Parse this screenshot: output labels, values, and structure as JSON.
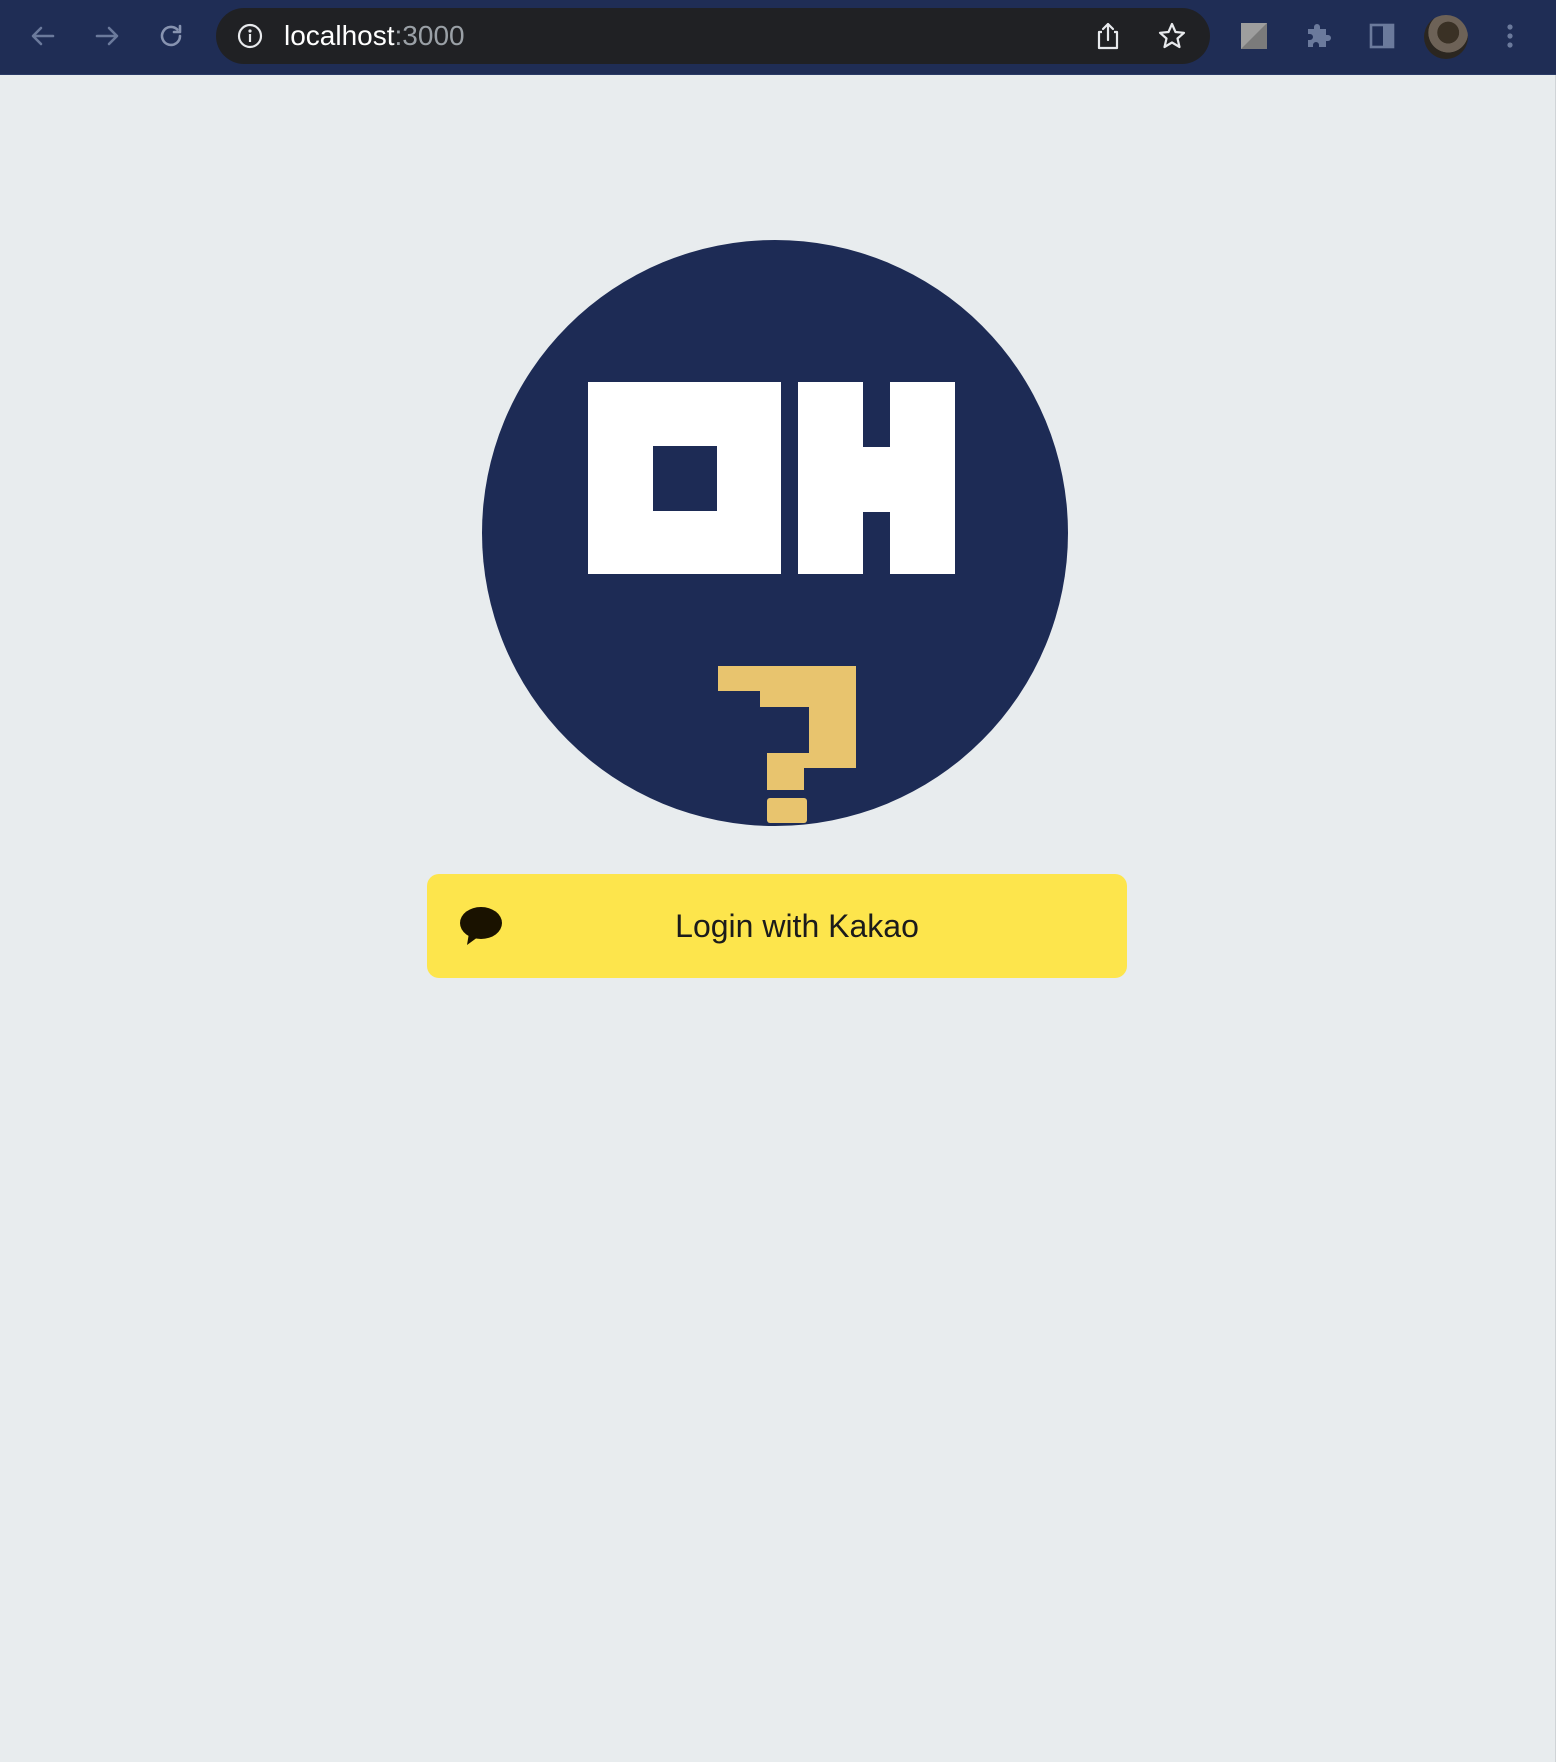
{
  "browser": {
    "url_host": "localhost",
    "url_port": ":3000",
    "icons": {
      "back": "arrow-left-icon",
      "forward": "arrow-right-icon",
      "reload": "reload-icon",
      "site_info": "info-icon",
      "share": "share-icon",
      "bookmark": "star-icon",
      "extension_tile": "extension-tile-icon",
      "extensions": "puzzle-icon",
      "side_panel": "side-panel-icon",
      "profile": "profile-avatar",
      "menu": "kebab-menu-icon"
    },
    "colors": {
      "toolbar": "#1f2d55",
      "omnibox": "#202124"
    }
  },
  "page": {
    "background": "#e8ecee",
    "logo": {
      "text": "OH?",
      "circle_color": "#1d2b55",
      "letters_color": "#ffffff",
      "question_color": "#e8c46e"
    },
    "login_button": {
      "label": "Login with Kakao",
      "icon": "speech-bubble-icon",
      "background": "#fde54c"
    }
  }
}
